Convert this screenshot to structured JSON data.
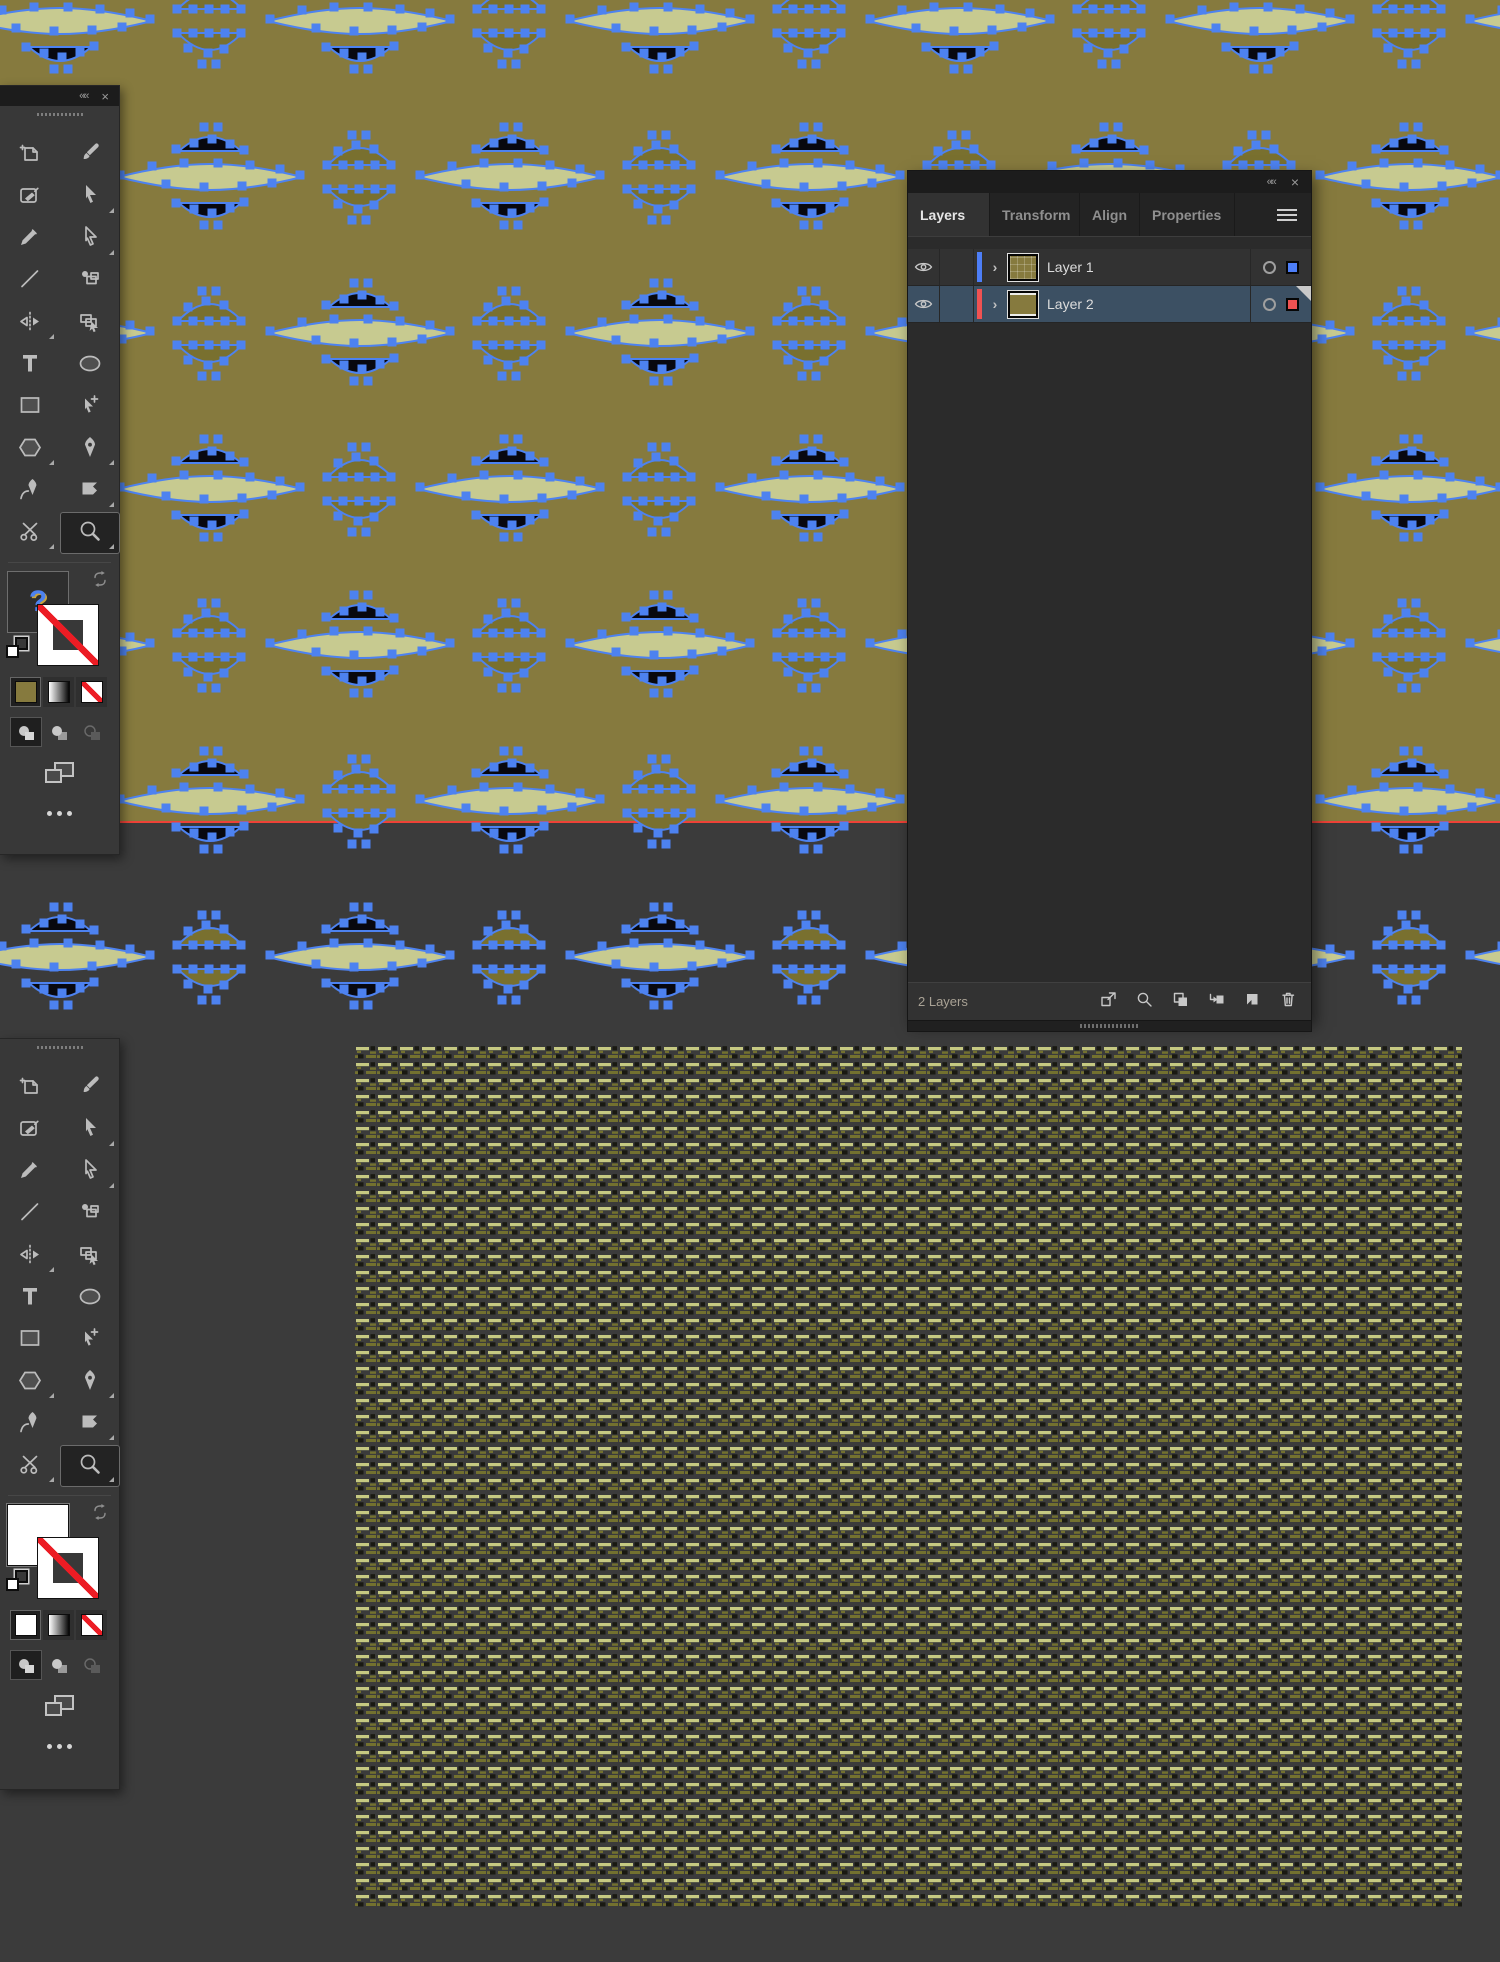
{
  "window": {
    "canvas_color": "#3b3b3b"
  },
  "artwork": {
    "background_color": "#867a3e",
    "leaf_color": "#c7ca90",
    "dark_shape_color": "#08080f",
    "cluster_fill_color": "#79702f",
    "anchor_color": "#4d82f0",
    "selection_edge_color": "#ee4237",
    "texture_bright": "#c6c982",
    "texture_dim": "#73712f",
    "texture_speck": "#191912"
  },
  "tool_set": [
    {
      "icon": "artboard-tool"
    },
    {
      "icon": "paintbrush-tool"
    },
    {
      "icon": "shaper-tool"
    },
    {
      "icon": "selection-tool",
      "flyout": true
    },
    {
      "icon": "pencil-tool"
    },
    {
      "icon": "direct-selection-tool",
      "flyout": true
    },
    {
      "icon": "line-segment-tool"
    },
    {
      "icon": "shape-builder-tool"
    },
    {
      "icon": "reflect-tool",
      "flyout": true
    },
    {
      "icon": "transform-tool"
    },
    {
      "icon": "type-tool"
    },
    {
      "icon": "ellipse-tool"
    },
    {
      "icon": "rectangle-tool"
    },
    {
      "icon": "group-selection-tool"
    },
    {
      "icon": "polygon-tool",
      "flyout": true
    },
    {
      "icon": "pen-tool",
      "flyout": true
    },
    {
      "icon": "curvature-tool"
    },
    {
      "icon": "eraser-tool",
      "flyout": true
    },
    {
      "icon": "scissors-tool",
      "flyout": true
    },
    {
      "icon": "zoom-tool",
      "active": true,
      "flyout": true
    }
  ],
  "toolbars": [
    {
      "has_header": true,
      "collapse_icon": "««",
      "close_icon": "×",
      "fill_swatch": {
        "type": "pattern",
        "label": "?"
      },
      "stroke_swatch": {
        "type": "none"
      },
      "color_button_color": "#867a3e",
      "modes": [
        "draw-normal",
        "draw-behind",
        "draw-inside"
      ]
    },
    {
      "has_header": false,
      "collapse_icon": "««",
      "close_icon": "×",
      "fill_swatch": {
        "type": "solid",
        "color": "#ffffff"
      },
      "stroke_swatch": {
        "type": "none"
      },
      "color_button_color": "#ffffff",
      "modes": [
        "draw-normal",
        "draw-behind",
        "draw-inside"
      ]
    }
  ],
  "layers_panel": {
    "collapse_icon": "««",
    "close_icon": "×",
    "tabs": [
      {
        "label": "Layers",
        "active": true
      },
      {
        "label": "Transform",
        "active": false
      },
      {
        "label": "Align",
        "active": false
      },
      {
        "label": "Properties",
        "active": false
      }
    ],
    "rows": [
      {
        "name": "Layer 1",
        "color": "#4d7ef7",
        "selected": false,
        "thumb": "pattern"
      },
      {
        "name": "Layer 2",
        "color": "#f05252",
        "selected": true,
        "thumb": "solid"
      }
    ],
    "status_text": "2 Layers",
    "buttons": [
      "collect-for-export",
      "locate-object",
      "make-clipping-mask",
      "create-new-sublayer",
      "create-new-layer",
      "delete-selection"
    ]
  }
}
